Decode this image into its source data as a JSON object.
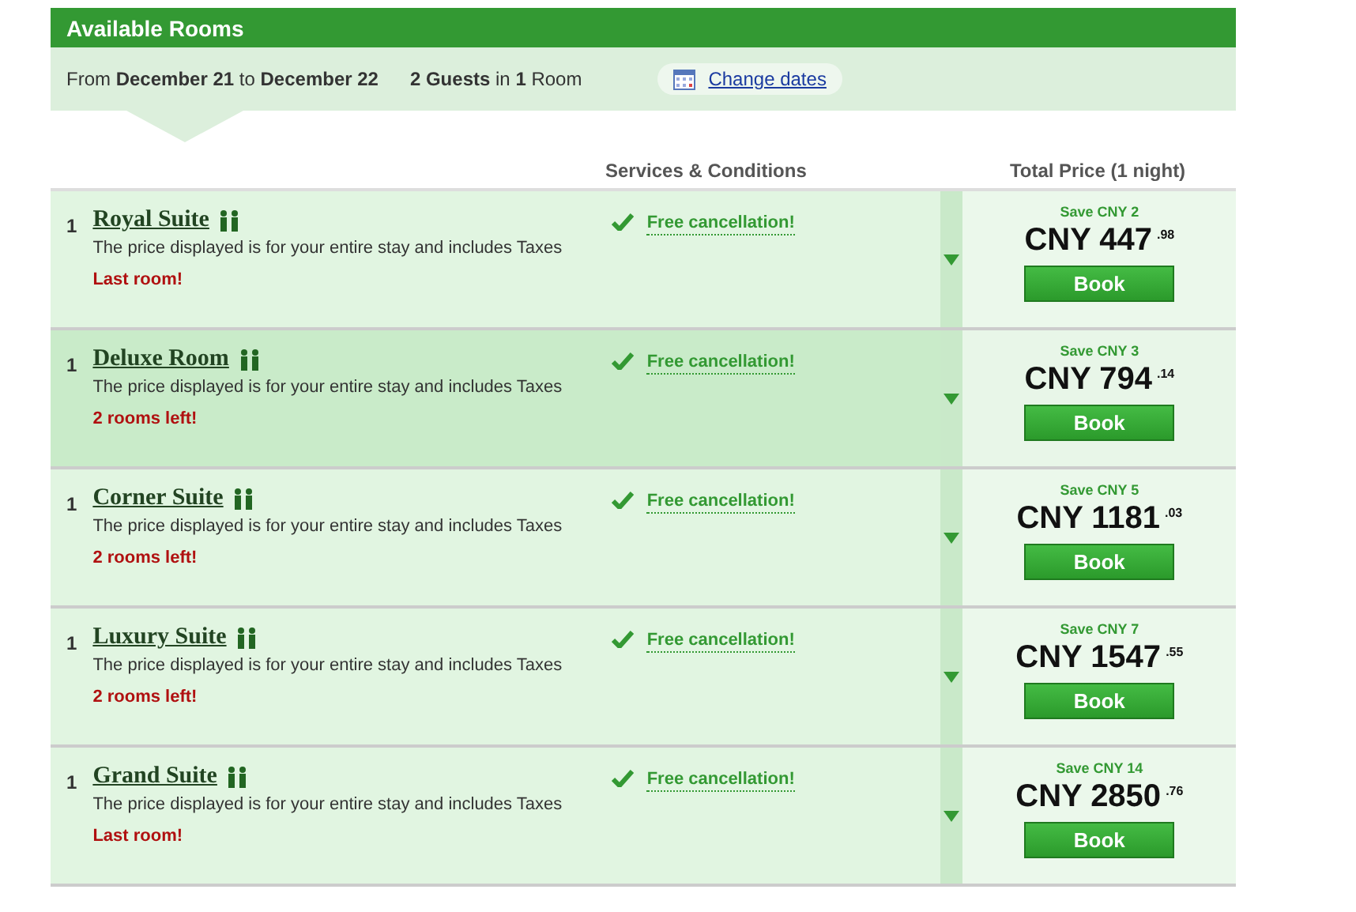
{
  "title": "Available Rooms",
  "summary": {
    "dates": "From **December 21** to **December 22**",
    "guests": "**2 Guests** in **1** Room",
    "change_link": "Change dates"
  },
  "columns": {
    "services": "Services & Conditions",
    "price": "Total Price (1 night)"
  },
  "rooms": [
    {
      "qty": "1",
      "name": "Royal Suite",
      "note": "The price displayed is for your entire stay and includes Taxes",
      "availability": "Last room!",
      "service": "Free cancellation!",
      "save": "Save CNY 2",
      "price": "CNY 447",
      "cents": ".98",
      "button": "Book",
      "highlighted": false
    },
    {
      "qty": "1",
      "name": "Deluxe Room",
      "note": "The price displayed is for your entire stay and includes Taxes",
      "availability": "2 rooms left!",
      "service": "Free cancellation!",
      "save": "Save CNY 3",
      "price": "CNY 794",
      "cents": ".14",
      "button": "Book",
      "highlighted": true
    },
    {
      "qty": "1",
      "name": "Corner Suite",
      "note": "The price displayed is for your entire stay and includes Taxes",
      "availability": "2 rooms left!",
      "service": "Free cancellation!",
      "save": "Save CNY 5",
      "price": "CNY 1181",
      "cents": ".03",
      "button": "Book",
      "highlighted": false
    },
    {
      "qty": "1",
      "name": "Luxury Suite",
      "note": "The price displayed is for your entire stay and includes Taxes",
      "availability": "2 rooms left!",
      "service": "Free cancellation!",
      "save": "Save CNY 7",
      "price": "CNY 1547",
      "cents": ".55",
      "button": "Book",
      "highlighted": false
    },
    {
      "qty": "1",
      "name": "Grand Suite",
      "note": "The price displayed is for your entire stay and includes Taxes",
      "availability": "Last room!",
      "service": "Free cancellation!",
      "save": "Save CNY 14",
      "price": "CNY 2850",
      "cents": ".76",
      "button": "Book",
      "highlighted": false
    }
  ]
}
